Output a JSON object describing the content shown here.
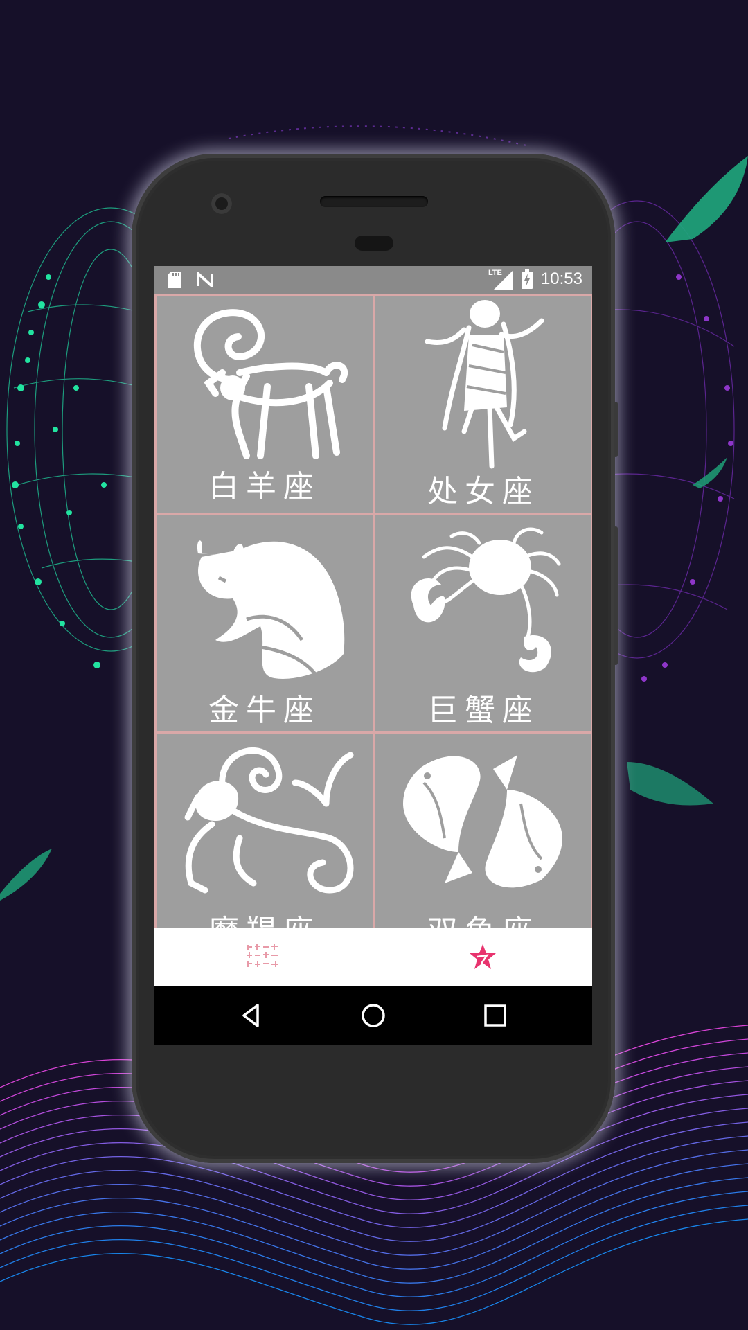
{
  "status_bar": {
    "time": "10:53",
    "network": "LTE",
    "icons": [
      "sd-card-icon",
      "n-notification-icon",
      "signal-icon",
      "battery-charging-icon"
    ]
  },
  "zodiac_grid": [
    {
      "label": "白羊座",
      "icon": "aries-ram-icon"
    },
    {
      "label": "处女座",
      "icon": "virgo-maiden-icon"
    },
    {
      "label": "金牛座",
      "icon": "taurus-bull-icon"
    },
    {
      "label": "巨蟹座",
      "icon": "cancer-crab-icon"
    },
    {
      "label": "摩羯座",
      "icon": "capricorn-seagoat-icon"
    },
    {
      "label": "双鱼座",
      "icon": "pisces-fish-icon"
    }
  ],
  "bottom_nav": {
    "tabs": [
      {
        "icon": "chinese-text-icon",
        "active": false
      },
      {
        "icon": "star-icon",
        "active": true
      }
    ]
  },
  "system_nav": {
    "buttons": [
      "back-icon",
      "home-icon",
      "recents-icon"
    ]
  },
  "colors": {
    "background": "#161029",
    "cell": "#9e9e9e",
    "cell_divider": "#d9a8a8",
    "status_bar": "#8a8a8a",
    "accent": "#e8336e",
    "glow_green": "#22e3a0",
    "glow_purple": "#9b3fd6",
    "wave_pink": "#e24ad6"
  }
}
